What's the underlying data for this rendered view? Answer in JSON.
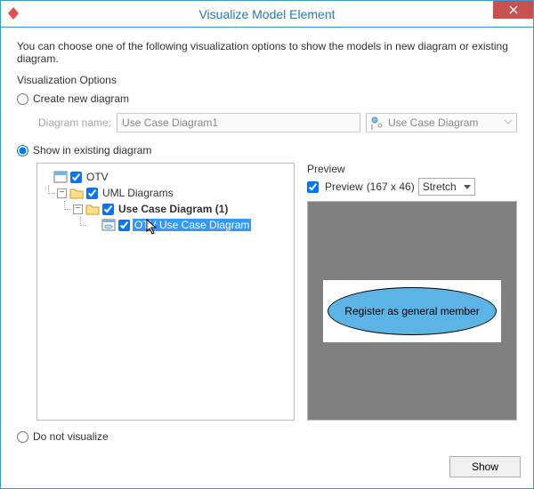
{
  "window": {
    "title": "Visualize Model Element"
  },
  "intro": "You can choose one of the following visualization options to show the models in new diagram or existing diagram.",
  "options_label": "Visualization Options",
  "radios": {
    "create": "Create new diagram",
    "show_existing": "Show in existing diagram",
    "do_not": "Do not visualize"
  },
  "diagram_name": {
    "label": "Diagram name:",
    "value": "Use Case Diagram1",
    "type": "Use Case Diagram"
  },
  "tree": {
    "root": {
      "label": "OTV"
    },
    "uml": {
      "label": "UML Diagrams"
    },
    "ucd": {
      "label": "Use Case Diagram (1)"
    },
    "otvucd": {
      "label": "OTV Use Case Diagram"
    }
  },
  "preview": {
    "label": "Preview",
    "check": "Preview",
    "dims": "(167 x 46)",
    "mode": "Stretch",
    "usecase_text": "Register as general member"
  },
  "footer": {
    "show": "Show"
  },
  "icons": {
    "close": "close-icon",
    "app": "app-icon"
  }
}
